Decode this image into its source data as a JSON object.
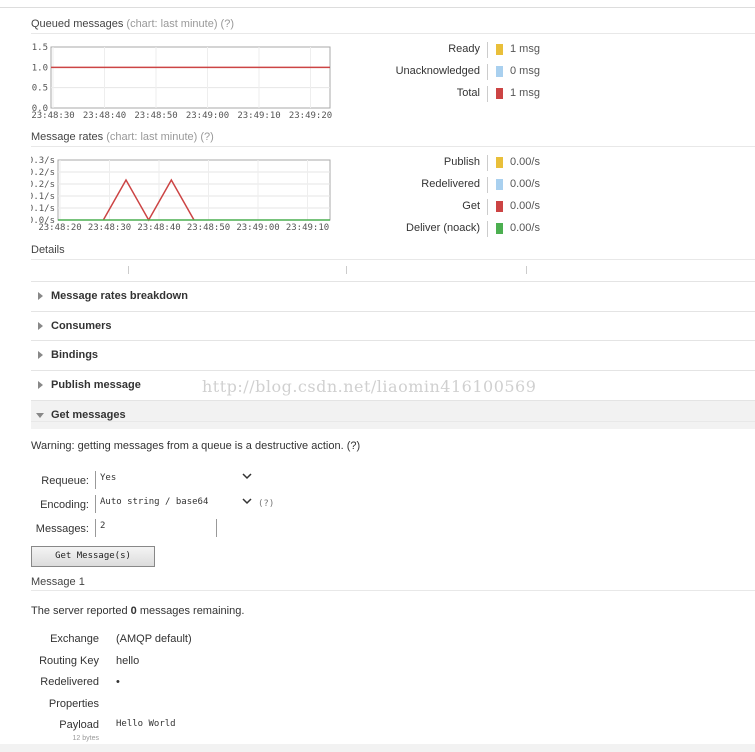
{
  "queued": {
    "title": "Queued messages",
    "subtitle": "(chart: last minute) (?)",
    "legend": [
      {
        "label": "Ready",
        "value": "1 msg",
        "color": "#e9bf3a"
      },
      {
        "label": "Unacknowledged",
        "value": "0 msg",
        "color": "#a9d0ef"
      },
      {
        "label": "Total",
        "value": "1 msg",
        "color": "#cc4444"
      }
    ]
  },
  "rates": {
    "title": "Message rates",
    "subtitle": "(chart: last minute) (?)",
    "legend": [
      {
        "label": "Publish",
        "value": "0.00/s",
        "color": "#e9bf3a"
      },
      {
        "label": "Redelivered",
        "value": "0.00/s",
        "color": "#a9d0ef"
      },
      {
        "label": "Get",
        "value": "0.00/s",
        "color": "#cc4444"
      },
      {
        "label": "Deliver (noack)",
        "value": "0.00/s",
        "color": "#4caf50"
      }
    ]
  },
  "details": {
    "title": "Details"
  },
  "sections": [
    {
      "label": "Message rates breakdown",
      "open": false
    },
    {
      "label": "Consumers",
      "open": false
    },
    {
      "label": "Bindings",
      "open": false
    },
    {
      "label": "Publish message",
      "open": false
    },
    {
      "label": "Get messages",
      "open": true
    }
  ],
  "get_messages": {
    "warning": "Warning: getting messages from a queue is a destructive action. (?)",
    "requeue_label": "Requeue:",
    "requeue_value": "Yes",
    "encoding_label": "Encoding:",
    "encoding_value": "Auto string / base64",
    "encoding_help": "(?)",
    "messages_label": "Messages:",
    "messages_value": "2",
    "button": "Get Message(s)"
  },
  "message": {
    "title": "Message 1",
    "server_prefix": "The server reported ",
    "remaining": "0",
    "server_suffix": " messages remaining.",
    "fields": [
      {
        "label": "Exchange",
        "value": "(AMQP default)"
      },
      {
        "label": "Routing Key",
        "value": "hello"
      },
      {
        "label": "Redelivered",
        "value": "•"
      },
      {
        "label": "Properties",
        "value": ""
      },
      {
        "label": "Payload",
        "value": "Hello World"
      }
    ],
    "payload_size": "12 bytes"
  },
  "watermark": "http://blog.csdn.net/liaomin416100569",
  "chart_data": [
    {
      "type": "line",
      "title": "Queued messages",
      "x": [
        "23:48:30",
        "23:48:40",
        "23:48:50",
        "23:49:00",
        "23:49:10",
        "23:49:20"
      ],
      "ylim": [
        0,
        1.5
      ],
      "yticks": [
        "0.0",
        "0.5",
        "1.0",
        "1.5"
      ],
      "grid": true,
      "legend": "right",
      "series": [
        {
          "name": "Total",
          "color": "#cc4444",
          "values": [
            1,
            1,
            1,
            1,
            1,
            1
          ]
        }
      ]
    },
    {
      "type": "line",
      "title": "Message rates",
      "x": [
        "23:48:20",
        "23:48:30",
        "23:48:40",
        "23:48:50",
        "23:49:00",
        "23:49:10"
      ],
      "ylim": [
        0,
        0.3
      ],
      "yticks": [
        "0.0/s",
        "0.1/s",
        "0.1/s",
        "0.2/s",
        "0.2/s",
        "0.3/s"
      ],
      "grid": true,
      "legend": "right",
      "series": [
        {
          "name": "Get",
          "color": "#cc4444",
          "points": [
            [
              10,
              0
            ],
            [
              15,
              0.2
            ],
            [
              20,
              0
            ],
            [
              25,
              0.2
            ],
            [
              30,
              0
            ]
          ]
        },
        {
          "name": "Deliver (noack)",
          "color": "#4caf50",
          "points": [
            [
              0,
              0
            ],
            [
              60,
              0
            ]
          ]
        }
      ]
    }
  ]
}
